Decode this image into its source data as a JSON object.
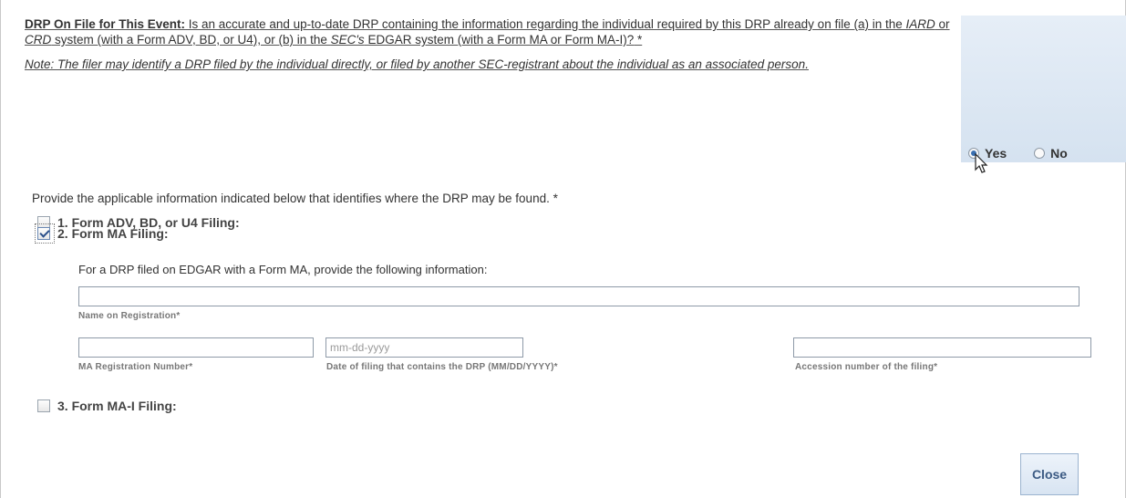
{
  "question": {
    "title": "DRP On File for This Event:",
    "text_part1": " Is an accurate and up-to-date DRP containing the information regarding the individual required by this DRP already on file (a) in the ",
    "iard": "IARD",
    "or": " or ",
    "crd": "CRD",
    "text_part2": " system (with a Form ADV, BD, or U4), or (b) in the ",
    "secs": "SEC's",
    "text_part3": " EDGAR system (with a Form MA or Form MA-I)?",
    "required_mark": " *",
    "note": "Note: The filer may identify a DRP filed by the individual directly, or filed by another SEC-registrant about the individual as an associated person."
  },
  "answer": {
    "yes_label": "Yes",
    "no_label": "No",
    "selected": "Yes"
  },
  "provide_text": "Provide the applicable information indicated below that identifies where the DRP may be found. *",
  "options": [
    {
      "label": "1. Form ADV, BD, or U4 Filing:",
      "checked": false
    },
    {
      "label": "2. Form MA Filing:",
      "checked": true
    },
    {
      "label": "3. Form MA-I Filing:",
      "checked": false
    }
  ],
  "form_ma": {
    "intro": "For a DRP filed on EDGAR with a Form MA, provide the following information:",
    "name_label": "Name on Registration*",
    "name_value": "",
    "reg_number_label": "MA Registration Number*",
    "reg_number_value": "",
    "date_label": "Date of filing that contains the DRP (MM/DD/YYYY)*",
    "date_placeholder": "mm-dd-yyyy",
    "accession_label": "Accession number of the filing*",
    "accession_value": ""
  },
  "close_label": "Close",
  "colors": {
    "panel": "#dce7f3",
    "button_text": "#3b5a83",
    "field_border": "#8e9aa8"
  }
}
